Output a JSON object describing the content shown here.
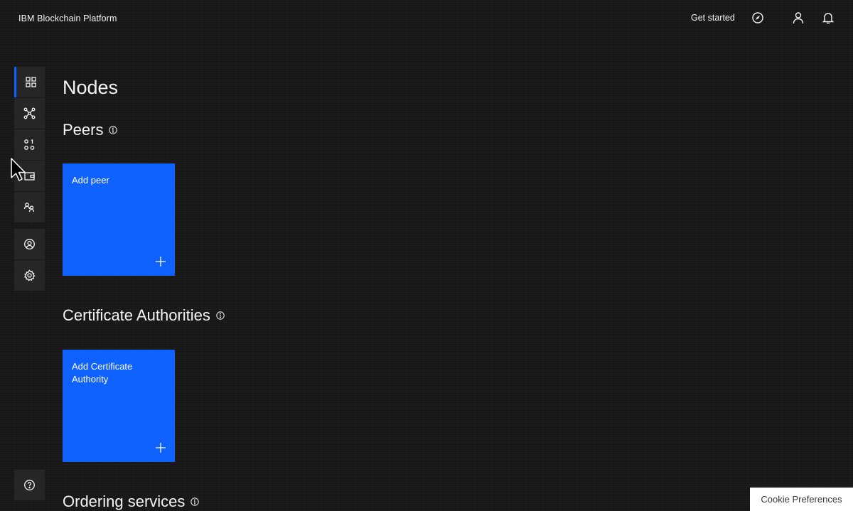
{
  "header": {
    "brand": "IBM Blockchain Platform",
    "get_started": "Get started",
    "icons": [
      "compass-icon",
      "user-icon",
      "notification-icon"
    ]
  },
  "sidenav": {
    "items": [
      {
        "icon": "nodes-icon",
        "active": true
      },
      {
        "icon": "channels-icon",
        "active": false
      },
      {
        "icon": "smart-contracts-icon",
        "active": false
      },
      {
        "icon": "wallet-icon",
        "active": false
      },
      {
        "icon": "organizations-icon",
        "active": false
      },
      {
        "icon": "users-icon",
        "active": false
      },
      {
        "icon": "settings-icon",
        "active": false
      },
      {
        "icon": "help-icon",
        "active": false
      }
    ]
  },
  "main": {
    "title": "Nodes",
    "sections": [
      {
        "title": "Peers",
        "tile_label": "Add peer"
      },
      {
        "title": "Certificate Authorities",
        "tile_label": "Add Certificate Authority"
      },
      {
        "title": "Ordering services"
      }
    ]
  },
  "cookie": {
    "label": "Cookie Preferences"
  },
  "colors": {
    "accent": "#0f62fe",
    "background": "#161616",
    "nav_bg": "#262626"
  }
}
